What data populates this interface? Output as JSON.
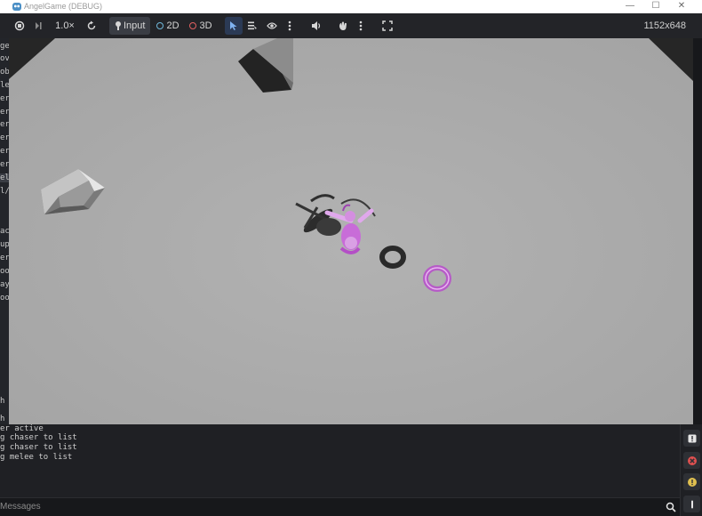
{
  "window": {
    "title": "AngelGame (DEBUG)",
    "controls": [
      "—",
      "☐",
      "✕"
    ]
  },
  "toolbar": {
    "zoom_label": "1.0×",
    "input_label": "Input",
    "mode_2d_label": "2D",
    "mode_3d_label": "3D",
    "resolution": "1152x648",
    "colors": {
      "accent_2d": "#6fb7d9",
      "accent_3d": "#e06060",
      "selected_bg": "#2b3a55"
    }
  },
  "left_panel": {
    "fragments": [
      "ge",
      "ov",
      "ob",
      "le",
      "er",
      "er",
      "er",
      "er",
      "er",
      "er",
      "el",
      "l/",
      "ac",
      "up",
      "er",
      "oo",
      "ay",
      "oo",
      "h",
      "h"
    ]
  },
  "console": {
    "lines": [
      "er active",
      "g chaser to list",
      "g chaser to list",
      "g melee to list"
    ],
    "filter_placeholder": "Messages"
  },
  "scene": {
    "ground_color": "#a9a9a9",
    "character_color": "#c86cd8",
    "ring_color": "#b65bc7"
  }
}
